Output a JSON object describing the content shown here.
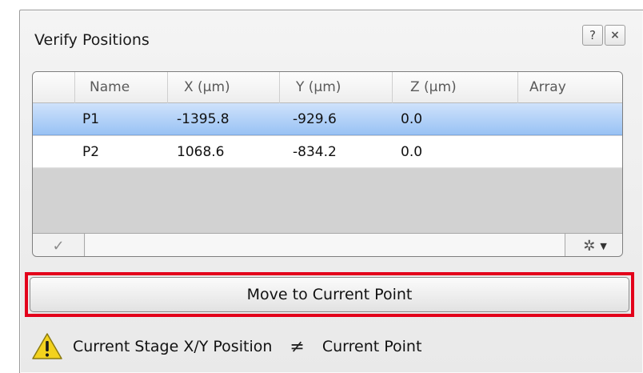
{
  "window": {
    "title": "Verify Positions",
    "help_label": "?",
    "close_label": "×"
  },
  "table": {
    "columns": [
      "Name",
      "X (µm)",
      "Y (µm)",
      "Z (µm)",
      "Array"
    ],
    "rows": [
      {
        "name": "P1",
        "x": "-1395.8",
        "y": "-929.6",
        "z": "0.0",
        "array": "",
        "selected": true
      },
      {
        "name": "P2",
        "x": "1068.6",
        "y": "-834.2",
        "z": "0.0",
        "array": "",
        "selected": false
      }
    ],
    "footer": {
      "check_icon": "checkmark-icon",
      "settings_icon": "gear-icon",
      "dropdown_icon": "chevron-down-icon"
    }
  },
  "actions": {
    "move_label": "Move to Current Point"
  },
  "status": {
    "left_text": "Current Stage X/Y Position",
    "symbol": "≠",
    "right_text": "Current Point",
    "icon": "warning-icon"
  },
  "colors": {
    "selection": "#99c2f4",
    "highlight_border": "#e3001b",
    "warning": "#f3d21e"
  }
}
